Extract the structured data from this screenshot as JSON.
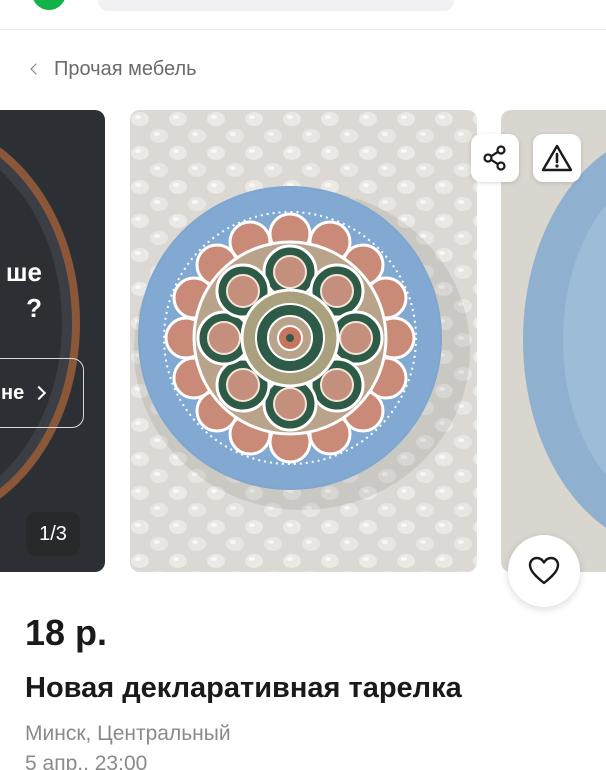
{
  "breadcrumb": {
    "label": "Прочая мебель"
  },
  "promo": {
    "text_line1": "ше",
    "text_line2": "?",
    "button_label": "не"
  },
  "gallery": {
    "counter": "1/3"
  },
  "listing": {
    "price": "18 р.",
    "title": "Новая декларативная тарелка",
    "location": "Минск, Центральный",
    "date": "5 апр., 23:00"
  },
  "colors": {
    "brand_green": "#13b34a",
    "plate_blue": "#7fa6cf",
    "text_primary": "#1a1a1a",
    "text_secondary": "#8a8a8a"
  },
  "icons": {
    "share": "share-icon",
    "report": "warning-icon",
    "favorite": "heart-icon",
    "back": "chevron-left-icon",
    "promo_arrow": "chevron-right-icon"
  }
}
